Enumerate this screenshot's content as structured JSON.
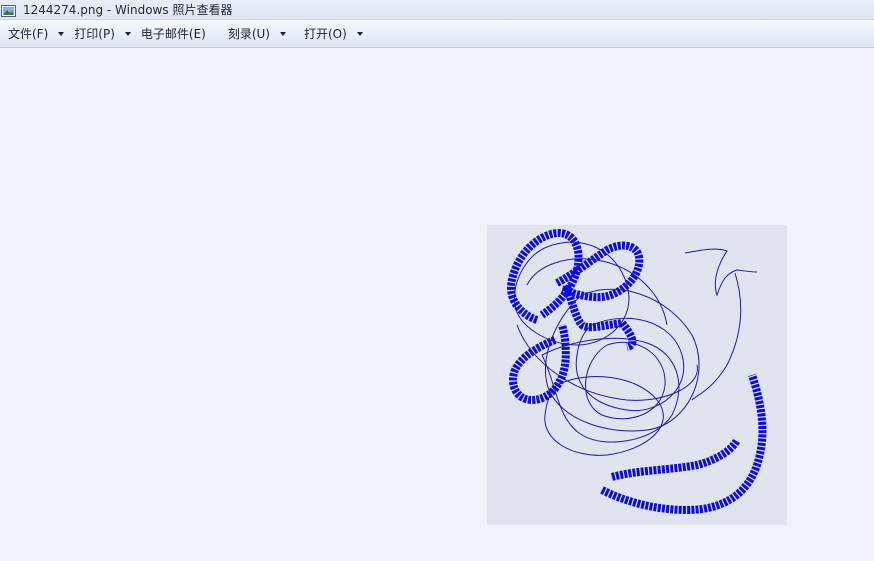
{
  "window": {
    "title": "1244274.png - Windows 照片查看器"
  },
  "menu": {
    "items": [
      {
        "label": "文件(F)",
        "has_dropdown": true
      },
      {
        "label": "打印(P)",
        "has_dropdown": true
      },
      {
        "label": "电子邮件(E)",
        "has_dropdown": false
      },
      {
        "label": "刻录(U)",
        "has_dropdown": true
      },
      {
        "label": "打开(O)",
        "has_dropdown": true
      }
    ]
  },
  "image": {
    "background_color": "#dfe4ee",
    "stroke_color": "#0a0aee",
    "thin_stroke_color": "#1a1ab8"
  }
}
